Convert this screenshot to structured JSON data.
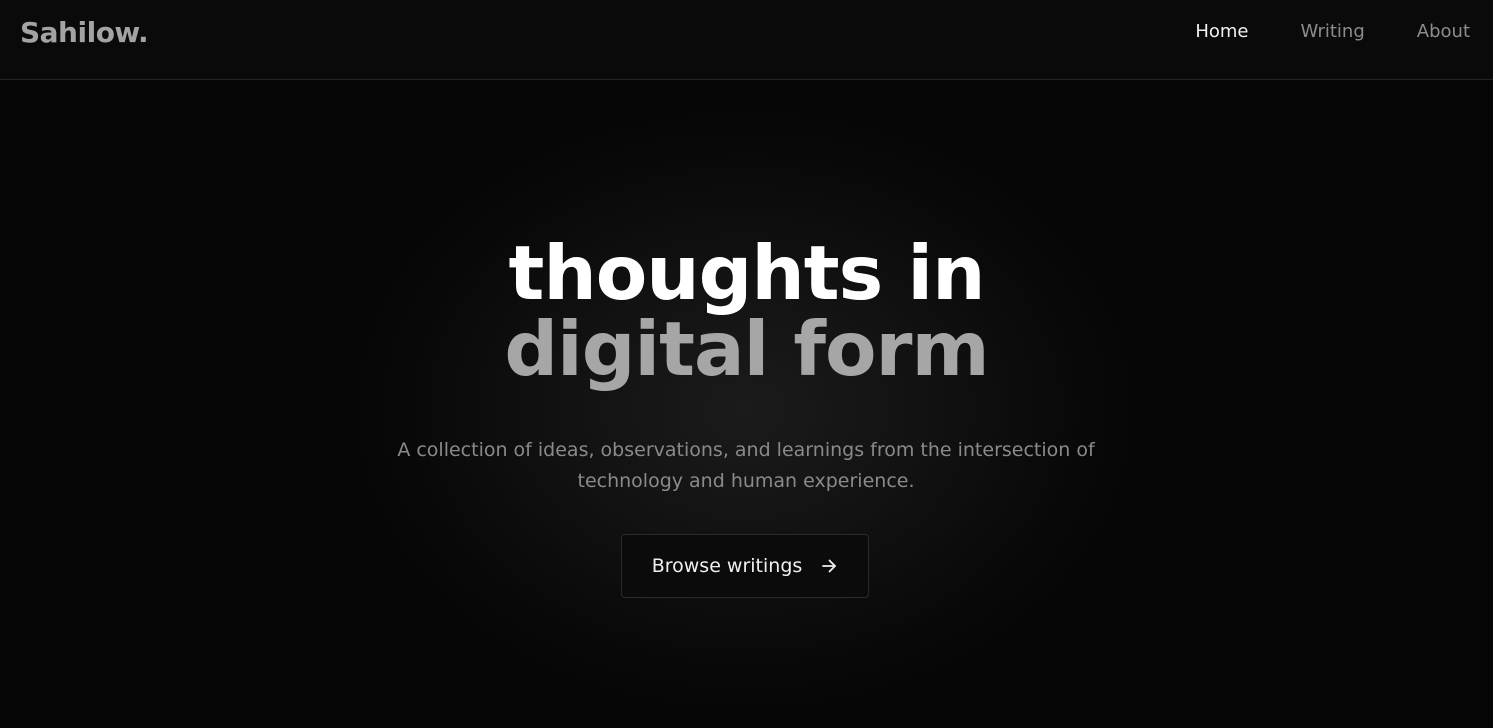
{
  "header": {
    "logo": "Sahilow.",
    "nav": [
      {
        "label": "Home",
        "active": true
      },
      {
        "label": "Writing",
        "active": false
      },
      {
        "label": "About",
        "active": false
      }
    ]
  },
  "hero": {
    "headline_line1": "thoughts in",
    "headline_line2": "digital form",
    "subtitle": "A collection of ideas, observations, and learnings from the intersection of technology and human experience.",
    "cta_label": "Browse writings",
    "cta_icon": "arrow-right-icon"
  },
  "colors": {
    "background": "#0a0a0a",
    "primary_text": "#ffffff",
    "muted_text": "#a6a6a6"
  }
}
